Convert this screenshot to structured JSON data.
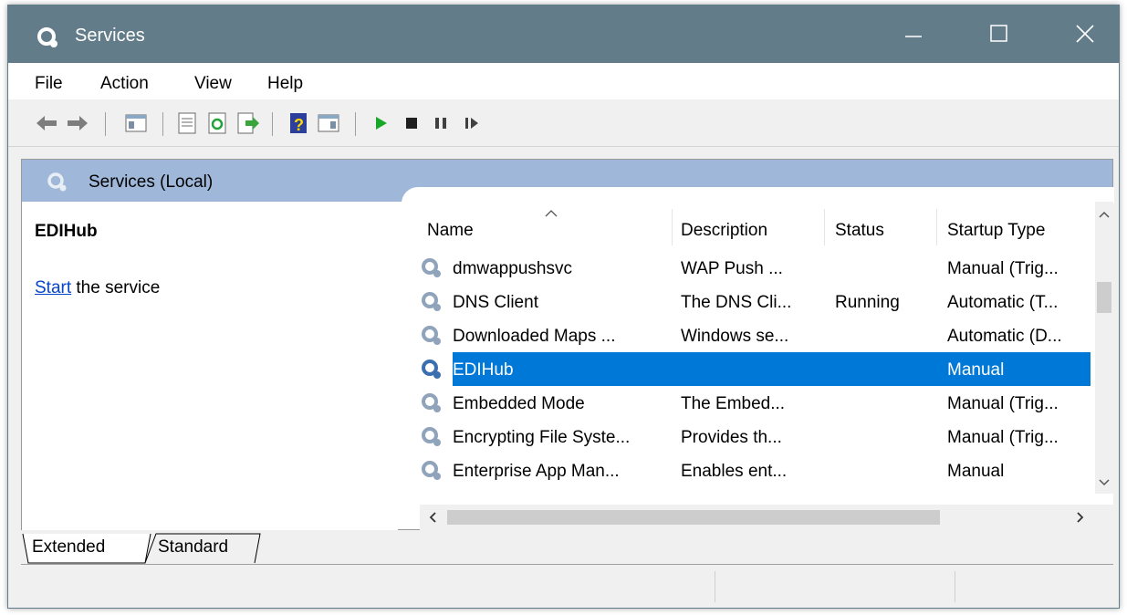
{
  "window": {
    "title": "Services"
  },
  "menu": [
    "File",
    "Action",
    "View",
    "Help"
  ],
  "toolbar": [
    "back-icon",
    "forward-icon",
    "show-hide-console-tree-icon",
    "properties-icon",
    "refresh-icon",
    "export-list-icon",
    "help-icon",
    "show-action-pane-icon",
    "start-service-icon",
    "stop-service-icon",
    "pause-service-icon",
    "resume-service-icon"
  ],
  "header": {
    "title": "Services (Local)"
  },
  "details": {
    "service_name": "EDIHub",
    "start_link": "Start",
    "start_rest": " the service"
  },
  "columns": [
    "Name",
    "Description",
    "Status",
    "Startup Type"
  ],
  "rows": [
    {
      "name": "dmwappushsvc",
      "description": "WAP Push ...",
      "status": "",
      "startup": "Manual (Trig..."
    },
    {
      "name": "DNS Client",
      "description": "The DNS Cli...",
      "status": "Running",
      "startup": "Automatic (T..."
    },
    {
      "name": "Downloaded Maps ...",
      "description": "Windows se...",
      "status": "",
      "startup": "Automatic (D..."
    },
    {
      "name": "EDIHub",
      "description": "",
      "status": "",
      "startup": "Manual",
      "selected": true
    },
    {
      "name": "Embedded Mode",
      "description": "The Embed...",
      "status": "",
      "startup": "Manual (Trig..."
    },
    {
      "name": "Encrypting File Syste...",
      "description": "Provides th...",
      "status": "",
      "startup": "Manual (Trig..."
    },
    {
      "name": "Enterprise App Man...",
      "description": "Enables ent...",
      "status": "",
      "startup": "Manual"
    }
  ],
  "tabs": [
    "Extended",
    "Standard"
  ],
  "colors": {
    "titlebar": "#637c8a",
    "header_band": "#9fb8d9",
    "selection": "#0078d7",
    "play_green": "#17a82a"
  }
}
